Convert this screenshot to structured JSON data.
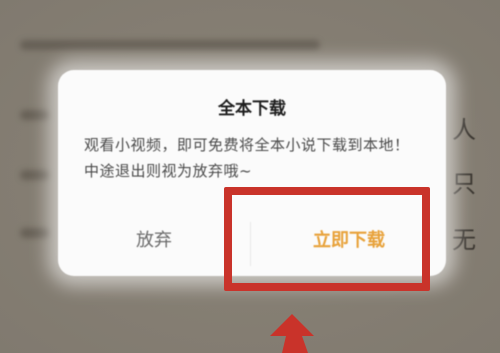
{
  "dialog": {
    "title": "全本下载",
    "message": "观看小视频，即可免费将全本小说下载到本地！中途退出则视为放弃哦~",
    "cancel_label": "放弃",
    "confirm_label": "立即下载"
  },
  "background_text": {
    "char1": "人",
    "char2": "只",
    "char3": "无"
  },
  "colors": {
    "confirm": "#e8a23a",
    "highlight": "#c9332a",
    "dialog_bg": "#fbfbfb"
  },
  "icons": {
    "annotation_arrow": "arrow-up-icon"
  }
}
